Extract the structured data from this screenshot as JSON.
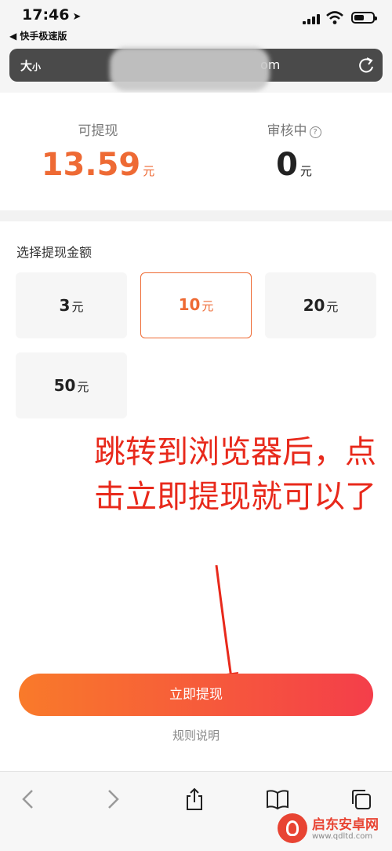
{
  "status_bar": {
    "time": "17:46",
    "back_app": "◀ 快手极速版"
  },
  "url_bar": {
    "aa_big": "大",
    "aa_small": "小",
    "url_tail": "om"
  },
  "balance": {
    "withdrawable_label": "可提现",
    "withdrawable_amount": "13.59",
    "withdrawable_unit": "元",
    "review_label": "审核中",
    "review_amount": "0",
    "review_unit": "元",
    "help_glyph": "?"
  },
  "selection": {
    "title": "选择提现金额",
    "options": [
      {
        "amount": "3",
        "unit": "元"
      },
      {
        "amount": "10",
        "unit": "元"
      },
      {
        "amount": "20",
        "unit": "元"
      },
      {
        "amount": "50",
        "unit": "元"
      }
    ]
  },
  "annotation": {
    "text": "跳转到浏览器后，点击立即提现就可以了"
  },
  "withdraw_button": "立即提现",
  "rules_link": "规则说明",
  "watermark": {
    "title": "启东安卓网",
    "url": "www.qdltd.com"
  },
  "colors": {
    "accent": "#ee6a34",
    "annotation": "#e8291b",
    "button_start": "#f97a2a",
    "button_end": "#f43e4a"
  }
}
